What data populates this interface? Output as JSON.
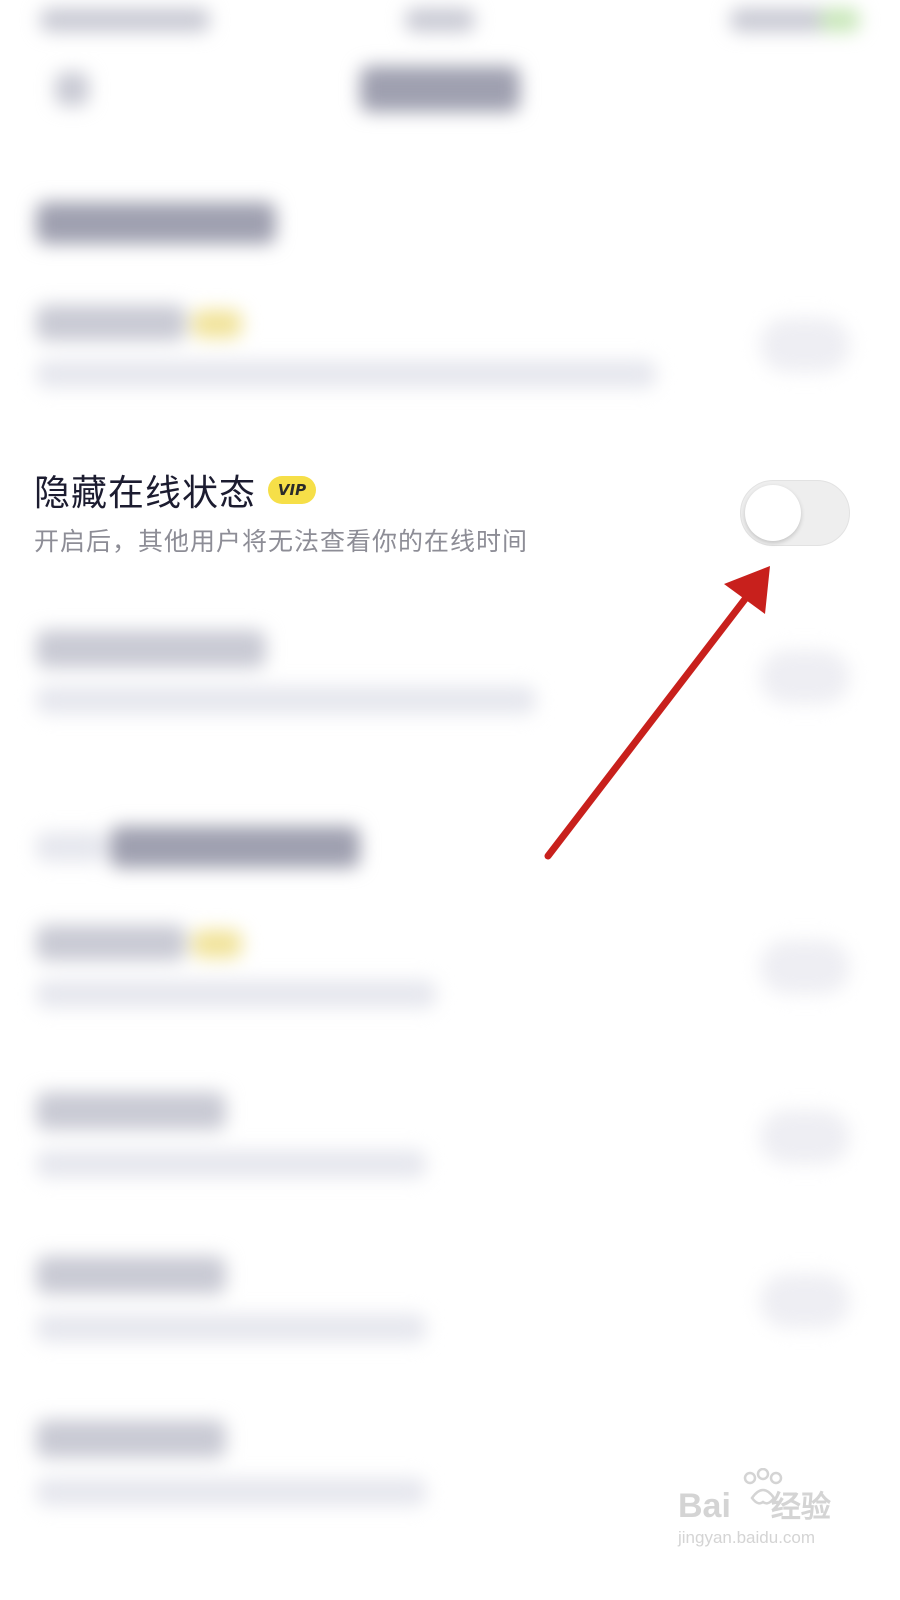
{
  "setting": {
    "title": "隐藏在线状态",
    "badge": "VIP",
    "description": "开启后，其他用户将无法查看你的在线时间",
    "toggle_state": "off"
  },
  "watermark": {
    "brand_left": "Bai",
    "brand_right": "经验",
    "url": "jingyan.baidu.com"
  },
  "colors": {
    "badge_bg": "#f6df48",
    "toggle_track": "#eeeeee",
    "arrow": "#c8201c",
    "description_text": "#8d8d96"
  }
}
